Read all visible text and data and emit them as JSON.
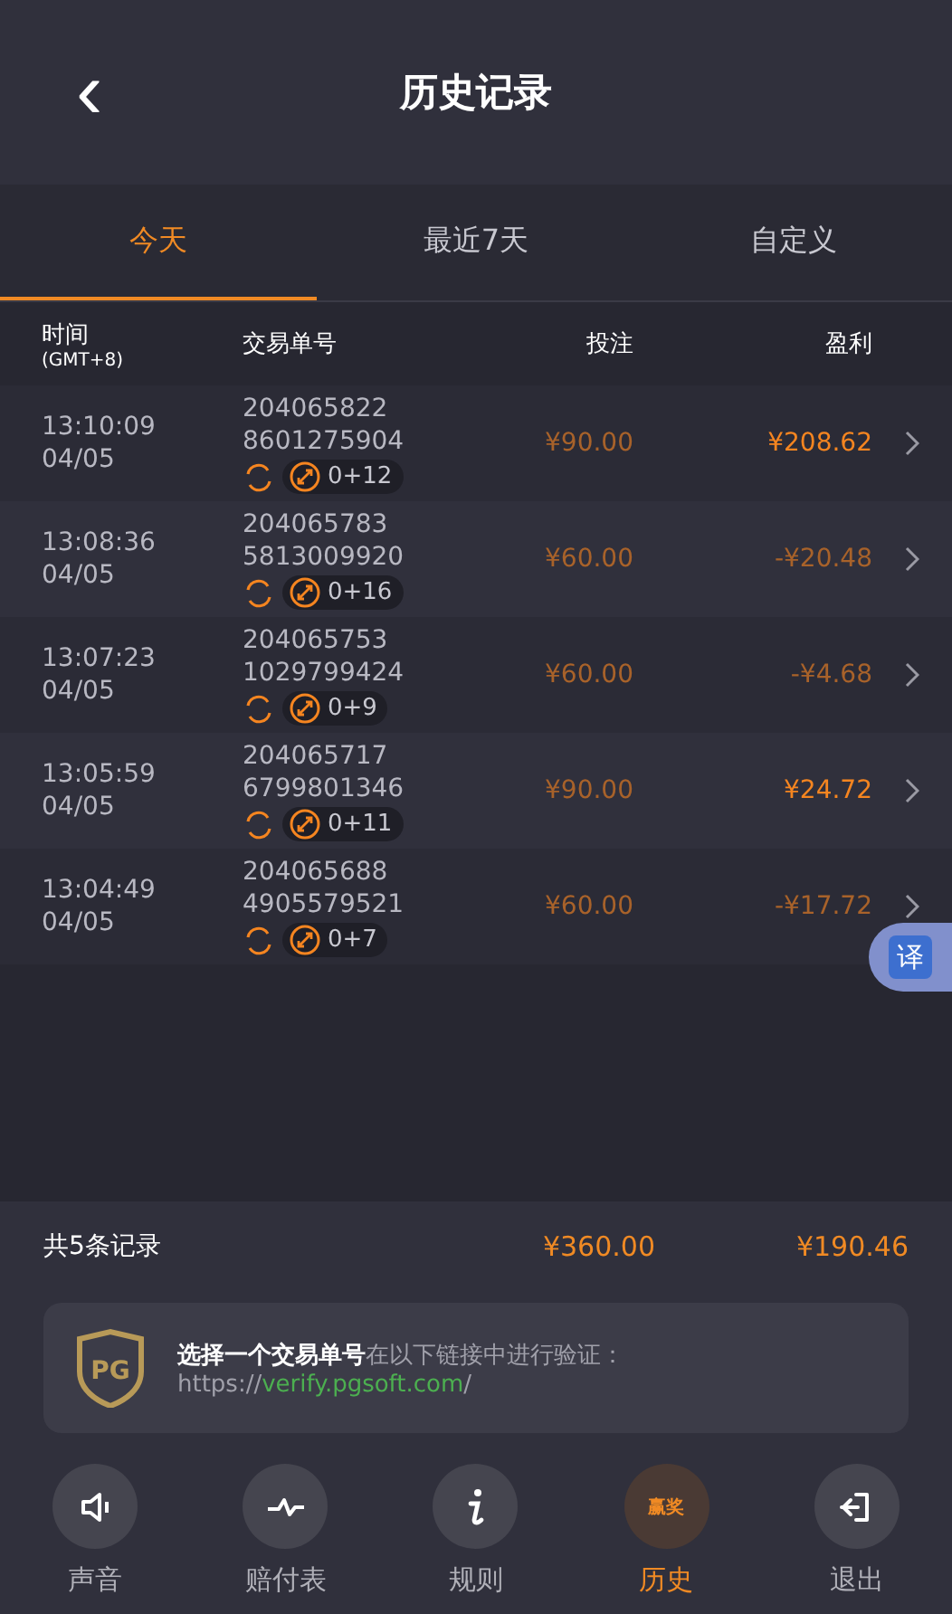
{
  "header": {
    "back": "‹",
    "title": "历史记录"
  },
  "tabs": [
    {
      "label": "今天",
      "selected": true
    },
    {
      "label": "最近7天",
      "selected": false
    },
    {
      "label": "自定义",
      "selected": false
    }
  ],
  "columns": {
    "time": "时间",
    "timezone": "(GMT+8)",
    "order": "交易单号",
    "bet": "投注",
    "profit": "盈利"
  },
  "rows": [
    {
      "time": "13:10:09",
      "date": "04/05",
      "order_1": "204065822",
      "order_2": "8601275904",
      "spins": "0+12",
      "bet": "¥90.00",
      "profit": "¥208.62",
      "kind": "win"
    },
    {
      "time": "13:08:36",
      "date": "04/05",
      "order_1": "204065783",
      "order_2": "5813009920",
      "spins": "0+16",
      "bet": "¥60.00",
      "profit": "-¥20.48",
      "kind": "loss"
    },
    {
      "time": "13:07:23",
      "date": "04/05",
      "order_1": "204065753",
      "order_2": "1029799424",
      "spins": "0+9",
      "bet": "¥60.00",
      "profit": "-¥4.68",
      "kind": "loss"
    },
    {
      "time": "13:05:59",
      "date": "04/05",
      "order_1": "204065717",
      "order_2": "6799801346",
      "spins": "0+11",
      "bet": "¥90.00",
      "profit": "¥24.72",
      "kind": "win"
    },
    {
      "time": "13:04:49",
      "date": "04/05",
      "order_1": "204065688",
      "order_2": "4905579521",
      "spins": "0+7",
      "bet": "¥60.00",
      "profit": "-¥17.72",
      "kind": "loss"
    }
  ],
  "translate_button": "译",
  "summary": {
    "count": "共5条记录",
    "bet": "¥360.00",
    "profit": "¥190.46"
  },
  "verify": {
    "text": "**选择一个交易单号**在以下链接中进行验证：",
    "url_prefix": "https://",
    "url_link": "verify.pgsoft.com",
    "url_suffix": "/",
    "logo": "PG"
  },
  "nav": [
    {
      "label": "声音",
      "kind": "sound",
      "selected": false
    },
    {
      "label": "赔付表",
      "kind": "paytable",
      "selected": false
    },
    {
      "label": "规则",
      "kind": "rules",
      "selected": false
    },
    {
      "label": "历史",
      "kind": "history",
      "selected": true,
      "icon_text": "赢奖"
    },
    {
      "label": "退出",
      "kind": "exit",
      "selected": false
    }
  ]
}
